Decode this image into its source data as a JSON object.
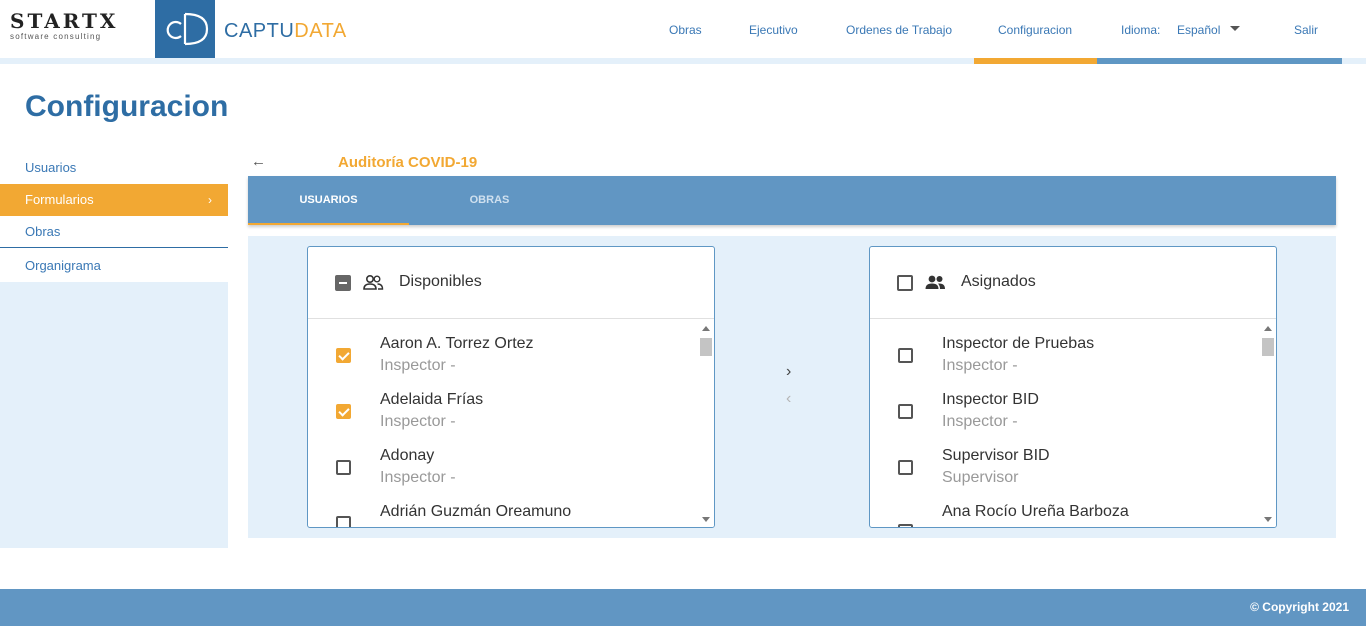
{
  "logo": {
    "startx_big": "STARTX",
    "startx_small": "software consulting",
    "captu_main": "CAPTU",
    "captu_accent": "DATA"
  },
  "nav": {
    "obras": "Obras",
    "ejecutivo": "Ejecutivo",
    "ordenes": "Ordenes de Trabajo",
    "configuracion": "Configuracion",
    "idioma_label": "Idioma:",
    "idioma_value": "Español",
    "salir": "Salir"
  },
  "page_title": "Configuracion",
  "sidebar": {
    "items": [
      {
        "label": "Usuarios",
        "active": false
      },
      {
        "label": "Formularios",
        "active": true
      },
      {
        "label": "Obras",
        "active": false
      },
      {
        "label": "Organigrama",
        "active": false
      }
    ]
  },
  "form": {
    "back_icon": "arrow-left-icon",
    "title": "Auditoría COVID-19"
  },
  "tabs": [
    {
      "label": "USUARIOS",
      "active": true
    },
    {
      "label": "OBRAS",
      "active": false
    }
  ],
  "disponibles": {
    "title": "Disponibles",
    "icon": "people-outline-icon",
    "items": [
      {
        "name": "Aaron A. Torrez Ortez",
        "role": "Inspector -",
        "checked": true
      },
      {
        "name": "Adelaida Frías",
        "role": "Inspector -",
        "checked": true
      },
      {
        "name": "Adonay",
        "role": "Inspector -",
        "checked": false
      },
      {
        "name": "Adrián Guzmán Oreamuno",
        "role": "",
        "checked": false
      }
    ]
  },
  "asignados": {
    "title": "Asignados",
    "icon": "people-filled-icon",
    "items": [
      {
        "name": "Inspector de Pruebas",
        "role": "Inspector -",
        "checked": false
      },
      {
        "name": "Inspector BID",
        "role": "Inspector -",
        "checked": false
      },
      {
        "name": "Supervisor BID",
        "role": "Supervisor",
        "checked": false
      },
      {
        "name": "Ana Rocío Ureña Barboza",
        "role": "",
        "checked": false
      }
    ]
  },
  "transfer": {
    "right": "›",
    "left": "‹"
  },
  "footer": {
    "copyright": "© Copyright 2021"
  },
  "colors": {
    "accent": "#f2a833",
    "brand": "#2e6da4",
    "bar": "#6196c3",
    "light_bg": "#e4f0fa"
  }
}
